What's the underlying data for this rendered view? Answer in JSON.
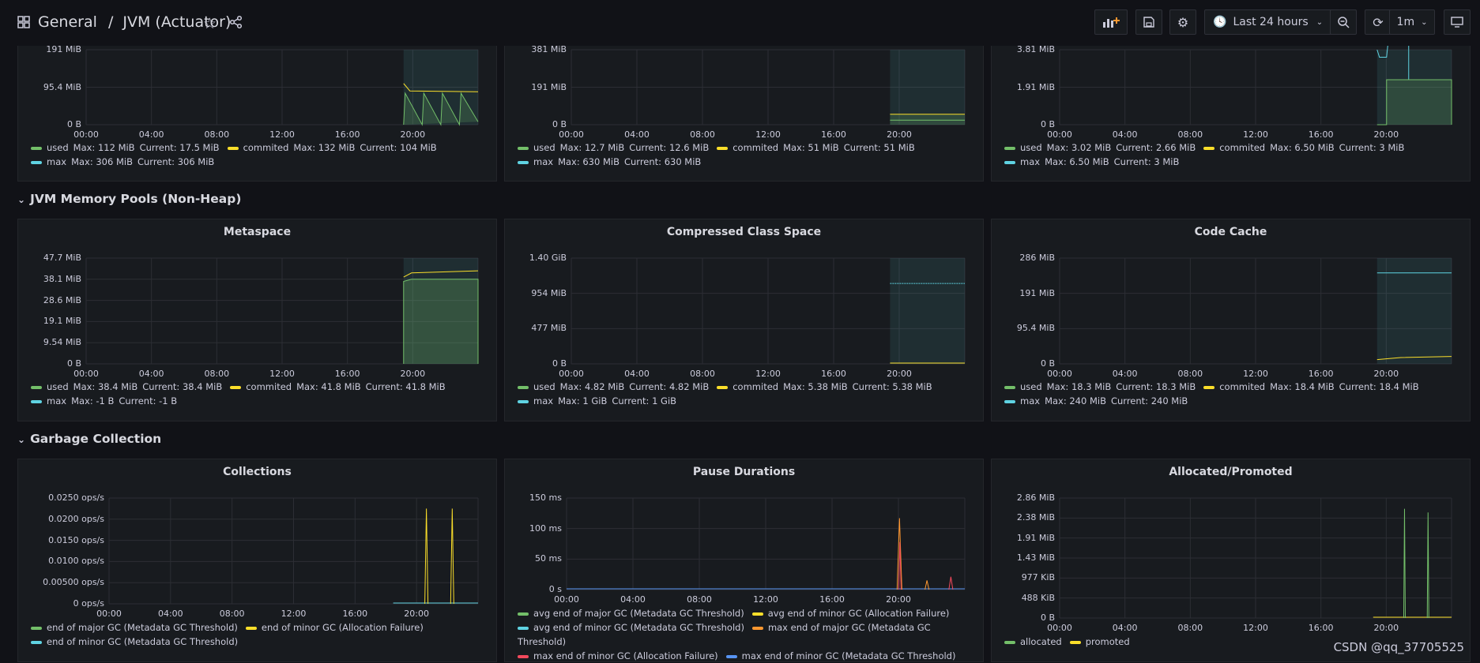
{
  "header": {
    "folder": "General",
    "separator": "/",
    "dashboard": "JVM (Actuator)",
    "time_range": "Last 24 hours",
    "refresh": "1m"
  },
  "rows": {
    "nonheap": "JVM Memory Pools (Non-Heap)",
    "gc": "Garbage Collection"
  },
  "x_ticks": [
    "00:00",
    "04:00",
    "08:00",
    "12:00",
    "16:00",
    "20:00"
  ],
  "colors": {
    "green": "#73bf69",
    "yellow": "#fade2a",
    "cyan": "#8ab8ff",
    "teal": "#5fd3e2",
    "orange": "#ff9830",
    "red": "#f2495c",
    "blue": "#5794f2"
  },
  "panels": [
    {
      "id": "p1",
      "title": "",
      "y_ticks": [
        "191 MiB",
        "95.4 MiB",
        "0 B"
      ],
      "legend": [
        [
          "used",
          "Max: 112 MiB",
          "Current: 17.5 MiB",
          "green"
        ],
        [
          "commited",
          "Max: 132 MiB",
          "Current: 104 MiB",
          "yellow"
        ],
        [
          "max",
          "Max: 306 MiB",
          "Current: 306 MiB",
          "teal"
        ]
      ]
    },
    {
      "id": "p2",
      "title": "",
      "y_ticks": [
        "381 MiB",
        "191 MiB",
        "0 B"
      ],
      "legend": [
        [
          "used",
          "Max: 12.7 MiB",
          "Current: 12.6 MiB",
          "green"
        ],
        [
          "commited",
          "Max: 51 MiB",
          "Current: 51 MiB",
          "yellow"
        ],
        [
          "max",
          "Max: 630 MiB",
          "Current: 630 MiB",
          "teal"
        ]
      ]
    },
    {
      "id": "p3",
      "title": "",
      "y_ticks": [
        "3.81 MiB",
        "1.91 MiB",
        "0 B"
      ],
      "legend": [
        [
          "used",
          "Max: 3.02 MiB",
          "Current: 2.66 MiB",
          "green"
        ],
        [
          "commited",
          "Max: 6.50 MiB",
          "Current: 3 MiB",
          "yellow"
        ],
        [
          "max",
          "Max: 6.50 MiB",
          "Current: 3 MiB",
          "teal"
        ]
      ]
    },
    {
      "id": "p4",
      "title": "Metaspace",
      "y_ticks": [
        "47.7 MiB",
        "38.1 MiB",
        "28.6 MiB",
        "19.1 MiB",
        "9.54 MiB",
        "0 B"
      ],
      "legend": [
        [
          "used",
          "Max: 38.4 MiB",
          "Current: 38.4 MiB",
          "green"
        ],
        [
          "commited",
          "Max: 41.8 MiB",
          "Current: 41.8 MiB",
          "yellow"
        ],
        [
          "max",
          "Max: -1 B",
          "Current: -1 B",
          "teal"
        ]
      ]
    },
    {
      "id": "p5",
      "title": "Compressed Class Space",
      "y_ticks": [
        "1.40 GiB",
        "954 MiB",
        "477 MiB",
        "0 B"
      ],
      "legend": [
        [
          "used",
          "Max: 4.82 MiB",
          "Current: 4.82 MiB",
          "green"
        ],
        [
          "commited",
          "Max: 5.38 MiB",
          "Current: 5.38 MiB",
          "yellow"
        ],
        [
          "max",
          "Max: 1 GiB",
          "Current: 1 GiB",
          "teal"
        ]
      ]
    },
    {
      "id": "p6",
      "title": "Code Cache",
      "y_ticks": [
        "286 MiB",
        "191 MiB",
        "95.4 MiB",
        "0 B"
      ],
      "legend": [
        [
          "used",
          "Max: 18.3 MiB",
          "Current: 18.3 MiB",
          "green"
        ],
        [
          "commited",
          "Max: 18.4 MiB",
          "Current: 18.4 MiB",
          "yellow"
        ],
        [
          "max",
          "Max: 240 MiB",
          "Current: 240 MiB",
          "teal"
        ]
      ]
    },
    {
      "id": "p7",
      "title": "Collections",
      "y_ticks": [
        "0.0250 ops/s",
        "0.0200 ops/s",
        "0.0150 ops/s",
        "0.0100 ops/s",
        "0.00500 ops/s",
        "0 ops/s"
      ],
      "legend": [
        [
          "end of major GC (Metadata GC Threshold)",
          "",
          "",
          "green"
        ],
        [
          "end of minor GC (Allocation Failure)",
          "",
          "",
          "yellow"
        ],
        [
          "end of minor GC (Metadata GC Threshold)",
          "",
          "",
          "teal"
        ]
      ]
    },
    {
      "id": "p8",
      "title": "Pause Durations",
      "y_ticks": [
        "150 ms",
        "100 ms",
        "50 ms",
        "0 s"
      ],
      "legend": [
        [
          "avg end of major GC (Metadata GC Threshold)",
          "",
          "",
          "green"
        ],
        [
          "avg end of minor GC (Allocation Failure)",
          "",
          "",
          "yellow"
        ],
        [
          "avg end of minor GC (Metadata GC Threshold)",
          "",
          "",
          "teal"
        ],
        [
          "max end of major GC (Metadata GC Threshold)",
          "",
          "",
          "orange"
        ],
        [
          "max end of minor GC (Allocation Failure)",
          "",
          "",
          "red"
        ],
        [
          "max end of minor GC (Metadata GC Threshold)",
          "",
          "",
          "blue"
        ]
      ]
    },
    {
      "id": "p9",
      "title": "Allocated/Promoted",
      "y_ticks": [
        "2.86 MiB",
        "2.38 MiB",
        "1.91 MiB",
        "1.43 MiB",
        "977 KiB",
        "488 KiB",
        "0 B"
      ],
      "legend": [
        [
          "allocated",
          "",
          "",
          "green"
        ],
        [
          "promoted",
          "",
          "",
          "yellow"
        ]
      ]
    }
  ],
  "watermark": "CSDN @qq_37705525"
}
